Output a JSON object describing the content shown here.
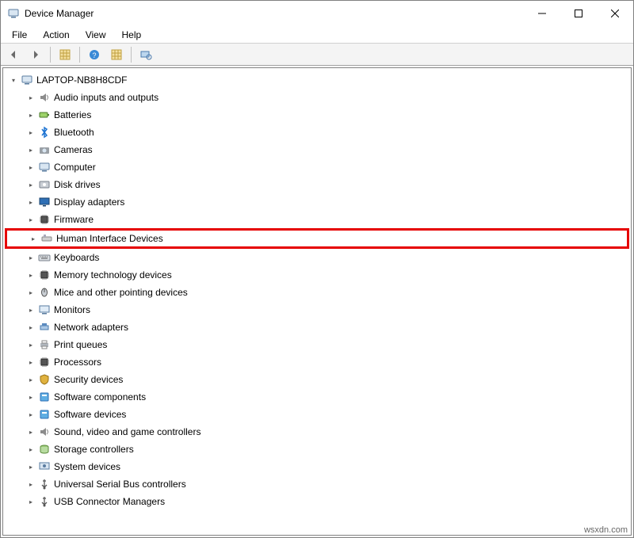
{
  "window": {
    "title": "Device Manager"
  },
  "menu": {
    "file": "File",
    "action": "Action",
    "view": "View",
    "help": "Help"
  },
  "toolbar": {
    "back": "back-arrow-icon",
    "forward": "forward-arrow-icon",
    "show_hidden": "show-hidden-icon",
    "help": "help-icon",
    "properties": "properties-icon",
    "scan": "scan-hardware-icon"
  },
  "tree": {
    "root": {
      "label": "LAPTOP-NB8H8CDF",
      "icon": "computer-icon"
    },
    "items": [
      {
        "label": "Audio inputs and outputs",
        "icon": "audio-icon",
        "highlighted": false
      },
      {
        "label": "Batteries",
        "icon": "battery-icon",
        "highlighted": false
      },
      {
        "label": "Bluetooth",
        "icon": "bluetooth-icon",
        "highlighted": false
      },
      {
        "label": "Cameras",
        "icon": "camera-icon",
        "highlighted": false
      },
      {
        "label": "Computer",
        "icon": "computer-icon",
        "highlighted": false
      },
      {
        "label": "Disk drives",
        "icon": "disk-icon",
        "highlighted": false
      },
      {
        "label": "Display adapters",
        "icon": "display-icon",
        "highlighted": false
      },
      {
        "label": "Firmware",
        "icon": "firmware-icon",
        "highlighted": false
      },
      {
        "label": "Human Interface Devices",
        "icon": "hid-icon",
        "highlighted": true
      },
      {
        "label": "Keyboards",
        "icon": "keyboard-icon",
        "highlighted": false
      },
      {
        "label": "Memory technology devices",
        "icon": "memory-icon",
        "highlighted": false
      },
      {
        "label": "Mice and other pointing devices",
        "icon": "mouse-icon",
        "highlighted": false
      },
      {
        "label": "Monitors",
        "icon": "monitor-icon",
        "highlighted": false
      },
      {
        "label": "Network adapters",
        "icon": "network-icon",
        "highlighted": false
      },
      {
        "label": "Print queues",
        "icon": "printer-icon",
        "highlighted": false
      },
      {
        "label": "Processors",
        "icon": "processor-icon",
        "highlighted": false
      },
      {
        "label": "Security devices",
        "icon": "security-icon",
        "highlighted": false
      },
      {
        "label": "Software components",
        "icon": "software-component-icon",
        "highlighted": false
      },
      {
        "label": "Software devices",
        "icon": "software-device-icon",
        "highlighted": false
      },
      {
        "label": "Sound, video and game controllers",
        "icon": "sound-icon",
        "highlighted": false
      },
      {
        "label": "Storage controllers",
        "icon": "storage-icon",
        "highlighted": false
      },
      {
        "label": "System devices",
        "icon": "system-icon",
        "highlighted": false
      },
      {
        "label": "Universal Serial Bus controllers",
        "icon": "usb-icon",
        "highlighted": false
      },
      {
        "label": "USB Connector Managers",
        "icon": "usb-connector-icon",
        "highlighted": false
      }
    ]
  },
  "watermark": "wsxdn.com"
}
